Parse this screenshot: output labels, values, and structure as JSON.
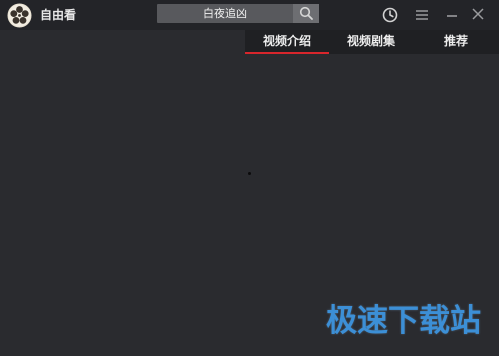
{
  "app": {
    "title": "自由看"
  },
  "search": {
    "value": "白夜追凶"
  },
  "tabs": [
    {
      "label": "视频介绍",
      "active": true
    },
    {
      "label": "视频剧集",
      "active": false
    },
    {
      "label": "推荐",
      "active": false
    }
  ],
  "watermark": {
    "text": "极速下载站"
  },
  "colors": {
    "background": "#2a2b2f",
    "titlebar": "#232428",
    "accent_underline": "#d8262c",
    "watermark": "#3c8fd6"
  },
  "icons": {
    "logo": "film-reel-icon",
    "search": "search-icon",
    "history": "clock-icon",
    "menu": "menu-icon",
    "minimize": "minimize-icon",
    "close": "close-icon"
  }
}
